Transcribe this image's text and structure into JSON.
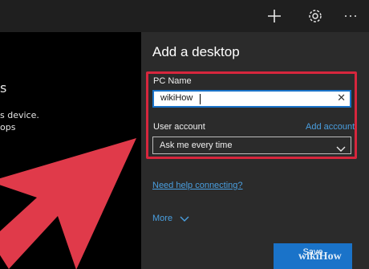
{
  "topbar": {
    "add_icon": "plus-icon",
    "settings_icon": "gear-icon",
    "more_icon": "more-icon"
  },
  "left": {
    "line1": "s",
    "line2": "s device.",
    "line3": "ops"
  },
  "panel": {
    "title": "Add a desktop",
    "pc_name_label": "PC Name",
    "pc_name_value": "wikiHow",
    "user_account_label": "User account",
    "add_account_link": "Add account",
    "user_account_value": "Ask me every time",
    "help_link": "Need help connecting?",
    "more_label": "More",
    "save_label": "Save"
  },
  "watermark": "wikiHow",
  "colors": {
    "accent": "#1a73c9",
    "highlight": "#d7263d",
    "arrow": "#e03a4a",
    "link": "#4a9fe0"
  }
}
